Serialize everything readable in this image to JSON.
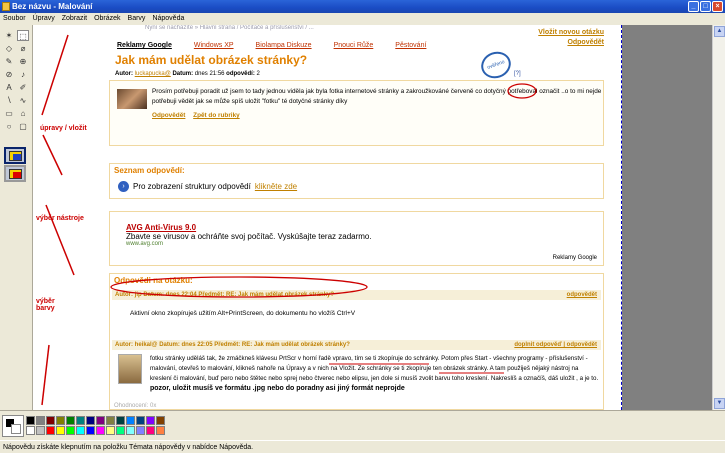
{
  "window": {
    "title": "Bez názvu - Malování",
    "min": "_",
    "max": "□",
    "close": "×"
  },
  "menu": [
    "Soubor",
    "Úpravy",
    "Zobrazit",
    "Obrázek",
    "Barvy",
    "Nápověda"
  ],
  "tools": [
    "✶",
    "⬚",
    "◇",
    "⌀",
    "✎",
    "⊕",
    "⊘",
    "♪",
    "A",
    "✐",
    "∖",
    "∿",
    "▭",
    "⌂",
    "○",
    "▢"
  ],
  "annotations": {
    "edit_copy": "úpravy / vložit",
    "select_tool": "výběr nástroje",
    "select_color": "výběr\nbarvy"
  },
  "palette": {
    "colors": [
      "#000000",
      "#808080",
      "#800000",
      "#808000",
      "#008000",
      "#008080",
      "#000080",
      "#800080",
      "#808040",
      "#004040",
      "#0080ff",
      "#004080",
      "#8000ff",
      "#804000",
      "#ffffff",
      "#c0c0c0",
      "#ff0000",
      "#ffff00",
      "#00ff00",
      "#00ffff",
      "#0000ff",
      "#ff00ff",
      "#ffff80",
      "#00ff80",
      "#80ffff",
      "#8080ff",
      "#ff0080",
      "#ff8040"
    ]
  },
  "status": "Nápovědu získáte klepnutím na položku Témata nápovědy v nabídce Nápověda.",
  "page": {
    "breadcrumb": "Nyní se nacházíte » Hlavní strana / Počítače a příslušenství / ...",
    "new_question": "Vložit novou otázku",
    "answer_link": "Odpovědět",
    "tabs": [
      "Reklamy Google",
      "Windows XP",
      "Biolampa Diskuze",
      "Pnouci Růže",
      "Pěstování"
    ],
    "question_title": "Jak mám udělat obrázek stránky?",
    "meta_author_label": "Autor:",
    "meta_author": "luckapucka@",
    "meta_date_label": "Datum:",
    "meta_date": "dnes 21:56",
    "meta_answers_label": "odpovědí:",
    "meta_answers": "2",
    "stamp_text": "ověřeno",
    "help_link": "[?]",
    "question_text": "Prosím potřebuji poradit už jsem to tady jednou viděla jak byla fotka internetové stránky a zakroužkováné červeně co dotyčný potřeboval označit ..o to mi nejde potřebuji vědět jak se může spíš uložit \"fotku\" té dotyčné stránky díky",
    "q_links": [
      "Odpovědět",
      "Zpět do rubriky"
    ],
    "structure_heading": "Seznam odpovědí:",
    "structure_text": "Pro zobrazení struktury odpovědí",
    "structure_link": "klikněte zde",
    "ad_title": "AVG Anti-Virus 9.0",
    "ad_desc": "Zbavte se virusov a ochráňte svoj počítač. Vyskúšajte teraz zadarmo.",
    "ad_url": "www.avg.com",
    "ad_google": "Reklamy Google",
    "answers_heading": "Odpovědi na otázku:",
    "post1_header": "Autor: jip  Datum: dnes 22:04  Předmět: RE: Jak mám udělat obrázek stránky?",
    "post1_reply": "odpovědět",
    "post1_text": "Aktivní okno zkopíruješ užitím Alt+PrintScreen, do dokumentu ho vložíš Ctrl+V",
    "post2_header": "Autor: heikal@  Datum: dnes 22:05  Předmět: RE: Jak mám udělat obrázek stránky?",
    "post2_reply": "doplnit odpověď | odpovědět",
    "post2_text": "fotku stránky uděláš tak, že zmáčkneš klávesu PrtScr v horní řadě vpravo, tím se ti zkopíruje do schránky. Potom přes Start - všechny programy - příslušenství - malování, otevřeš to malování, klikneš nahoře na Úpravy a v nich na Vložit. Ze schránky se ti zkopíruje ten obrázek stránky. A tam použiješ nějaký nástroj na kreslení či malování, buď pero nebo štětec nebo sprej nebo čtverec nebo elipsu, jen dole si musíš zvolit barvu toho kreslení. Nakreslíš a označíš, dáš uložit , a je to.",
    "post2_bold": "pozor, uložit musíš ve formátu .jpg nebo do poradny asi jiný formát neprojde",
    "post2_footer": "Ohodnocení: 0x"
  }
}
